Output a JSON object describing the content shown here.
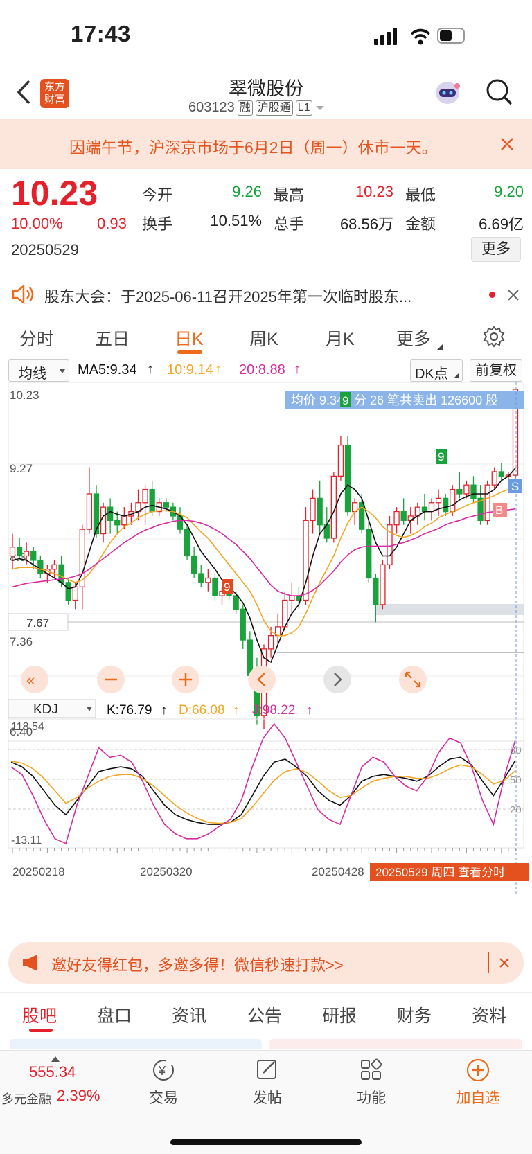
{
  "status_bar": {
    "time": "17:43"
  },
  "header": {
    "logo": "东方\n财富",
    "logo_top": "东方",
    "logo_bottom": "财富",
    "title": "翠微股份",
    "code": "603123",
    "tags": [
      "融",
      "沪股通",
      "L1"
    ]
  },
  "banner": {
    "text": "因端午节，沪深京市场于6月2日（周一）休市一天。"
  },
  "quote": {
    "price": "10.23",
    "change_pct": "10.00%",
    "change": "0.93",
    "date": "20250529",
    "open_label": "今开",
    "open": "9.26",
    "high_label": "最高",
    "high": "10.23",
    "low_label": "最低",
    "low": "9.20",
    "turnover_label": "换手",
    "turnover": "10.51%",
    "volume_label": "总手",
    "volume": "68.56万",
    "amount_label": "金额",
    "amount": "6.69亿",
    "more_label": "更多"
  },
  "notice": {
    "text": "股东大会：于2025-06-11召开2025年第一次临时股东..."
  },
  "tabs": [
    "分时",
    "五日",
    "日K",
    "周K",
    "月K",
    "更多"
  ],
  "ma": {
    "selector": "均线",
    "ma5": "MA5:9.34",
    "ma10": "10:9.14",
    "ma20": "20:8.88",
    "dk": "DK点",
    "adjust": "前复权"
  },
  "chart": {
    "axis_labels": [
      "10.23",
      "9.27",
      "8.3",
      "7.36",
      "6.40"
    ],
    "price_line_label": "7.67",
    "tooltip": "均价 9.342 分 26 笔共卖出 126600 股",
    "kdj_selector": "KDJ",
    "kdj_k": "K:76.79",
    "kdj_d": "D:66.08",
    "kdj_j": "J:98.22",
    "kdj_axis": [
      "118.54",
      "-13.11"
    ],
    "kdj_levels": [
      "80",
      "50",
      "20"
    ],
    "dates": [
      "20250218",
      "20250320",
      "20250428",
      "20250529"
    ],
    "date_tip": "20250529 周四 查看分时"
  },
  "chart_data": {
    "type": "candlestick",
    "ylim": [
      6.4,
      10.23
    ],
    "grid": true,
    "ohlc": [
      [
        8.35,
        8.6,
        8.2,
        8.45
      ],
      [
        8.45,
        8.55,
        8.3,
        8.35
      ],
      [
        8.35,
        8.5,
        8.25,
        8.4
      ],
      [
        8.4,
        8.45,
        8.2,
        8.3
      ],
      [
        8.3,
        8.35,
        8.1,
        8.15
      ],
      [
        8.15,
        8.25,
        8.05,
        8.2
      ],
      [
        8.2,
        8.3,
        8.1,
        8.25
      ],
      [
        8.25,
        8.35,
        8.0,
        8.05
      ],
      [
        8.05,
        8.1,
        7.8,
        7.85
      ],
      [
        7.85,
        8.05,
        7.75,
        8.0
      ],
      [
        8.0,
        8.7,
        7.75,
        8.65
      ],
      [
        8.65,
        9.35,
        8.6,
        9.05
      ],
      [
        9.05,
        9.15,
        8.55,
        8.6
      ],
      [
        8.6,
        8.95,
        8.5,
        8.9
      ],
      [
        8.9,
        9.0,
        8.6,
        8.75
      ],
      [
        8.75,
        8.85,
        8.6,
        8.7
      ],
      [
        8.7,
        8.9,
        8.65,
        8.8
      ],
      [
        8.8,
        8.95,
        8.7,
        8.85
      ],
      [
        8.85,
        9.1,
        8.75,
        8.95
      ],
      [
        8.95,
        9.15,
        8.7,
        9.1
      ],
      [
        9.1,
        9.2,
        8.8,
        8.85
      ],
      [
        8.85,
        9.0,
        8.8,
        8.95
      ],
      [
        8.95,
        9.0,
        8.85,
        8.9
      ],
      [
        8.9,
        8.95,
        8.75,
        8.8
      ],
      [
        8.8,
        8.9,
        8.6,
        8.65
      ],
      [
        8.65,
        8.7,
        8.3,
        8.35
      ],
      [
        8.35,
        8.45,
        8.1,
        8.15
      ],
      [
        8.15,
        8.25,
        8.0,
        8.05
      ],
      [
        8.05,
        8.2,
        7.95,
        8.1
      ],
      [
        8.1,
        8.15,
        7.85,
        7.9
      ],
      [
        7.9,
        8.0,
        7.8,
        7.95
      ],
      [
        7.95,
        8.05,
        7.85,
        7.9
      ],
      [
        7.9,
        7.95,
        7.7,
        7.75
      ],
      [
        7.75,
        7.8,
        7.3,
        7.4
      ],
      [
        7.4,
        7.5,
        6.9,
        7.0
      ],
      [
        7.0,
        7.2,
        6.45,
        6.55
      ],
      [
        6.55,
        7.35,
        6.4,
        7.3
      ],
      [
        7.3,
        7.55,
        7.2,
        7.45
      ],
      [
        7.45,
        7.7,
        7.35,
        7.55
      ],
      [
        7.55,
        7.95,
        7.5,
        7.85
      ],
      [
        7.85,
        8.05,
        7.7,
        7.9
      ],
      [
        7.9,
        8.0,
        7.75,
        7.85
      ],
      [
        7.85,
        8.9,
        7.8,
        8.75
      ],
      [
        8.75,
        9.1,
        8.6,
        9.0
      ],
      [
        9.0,
        9.2,
        8.6,
        8.7
      ],
      [
        8.7,
        8.9,
        8.5,
        8.55
      ],
      [
        8.55,
        9.3,
        8.5,
        9.25
      ],
      [
        9.25,
        9.7,
        9.2,
        9.6
      ],
      [
        9.6,
        9.7,
        8.8,
        8.85
      ],
      [
        8.85,
        9.0,
        8.7,
        8.95
      ],
      [
        8.95,
        9.05,
        8.6,
        8.65
      ],
      [
        8.65,
        8.75,
        8.05,
        8.1
      ],
      [
        8.1,
        8.15,
        7.6,
        7.8
      ],
      [
        7.8,
        8.3,
        7.75,
        8.25
      ],
      [
        8.25,
        8.8,
        8.2,
        8.7
      ],
      [
        8.7,
        8.9,
        8.6,
        8.85
      ],
      [
        8.85,
        9.0,
        8.7,
        8.75
      ],
      [
        8.75,
        8.9,
        8.6,
        8.8
      ],
      [
        8.8,
        8.95,
        8.7,
        8.9
      ],
      [
        8.9,
        9.05,
        8.75,
        8.85
      ],
      [
        8.85,
        9.0,
        8.75,
        8.95
      ],
      [
        8.95,
        9.1,
        8.8,
        9.0
      ],
      [
        9.0,
        9.05,
        8.8,
        8.85
      ],
      [
        8.85,
        9.15,
        8.8,
        9.1
      ],
      [
        9.1,
        9.3,
        9.0,
        9.05
      ],
      [
        9.05,
        9.2,
        9.0,
        9.15
      ],
      [
        9.15,
        9.25,
        8.95,
        9.0
      ],
      [
        9.0,
        9.15,
        8.7,
        8.75
      ],
      [
        8.75,
        9.2,
        8.7,
        9.15
      ],
      [
        9.15,
        9.35,
        9.1,
        9.3
      ],
      [
        9.3,
        9.4,
        9.2,
        9.25
      ],
      [
        9.25,
        9.3,
        9.2,
        9.26
      ],
      [
        9.26,
        10.23,
        9.2,
        10.23
      ]
    ],
    "ma5": [
      8.3,
      8.32,
      8.3,
      8.25,
      8.2,
      8.15,
      8.1,
      8.05,
      7.98,
      8.0,
      8.15,
      8.4,
      8.65,
      8.8,
      8.85,
      8.82,
      8.8,
      8.82,
      8.85,
      8.9,
      8.92,
      8.9,
      8.88,
      8.85,
      8.8,
      8.7,
      8.55,
      8.4,
      8.3,
      8.2,
      8.08,
      8.0,
      7.92,
      7.82,
      7.65,
      7.4,
      7.2,
      7.15,
      7.35,
      7.55,
      7.7,
      7.8,
      8.05,
      8.35,
      8.6,
      8.7,
      8.85,
      9.05,
      9.15,
      9.1,
      9.0,
      8.75,
      8.5,
      8.35,
      8.35,
      8.45,
      8.6,
      8.75,
      8.8,
      8.85,
      8.85,
      8.88,
      8.9,
      8.92,
      8.98,
      9.02,
      9.05,
      9.05,
      9.05,
      9.1,
      9.2,
      9.25,
      9.34
    ],
    "ma10": [
      8.2,
      8.22,
      8.22,
      8.22,
      8.2,
      8.18,
      8.15,
      8.12,
      8.08,
      8.05,
      8.08,
      8.15,
      8.25,
      8.38,
      8.5,
      8.6,
      8.68,
      8.72,
      8.78,
      8.82,
      8.85,
      8.86,
      8.86,
      8.85,
      8.82,
      8.78,
      8.7,
      8.62,
      8.55,
      8.45,
      8.35,
      8.25,
      8.15,
      8.05,
      7.95,
      7.8,
      7.62,
      7.5,
      7.45,
      7.45,
      7.48,
      7.55,
      7.7,
      7.88,
      8.05,
      8.2,
      8.35,
      8.55,
      8.72,
      8.85,
      8.9,
      8.85,
      8.78,
      8.68,
      8.62,
      8.58,
      8.56,
      8.58,
      8.62,
      8.68,
      8.72,
      8.78,
      8.82,
      8.85,
      8.88,
      8.92,
      8.95,
      8.97,
      9.0,
      9.03,
      9.07,
      9.1,
      9.14
    ],
    "ma20": [
      8.0,
      8.02,
      8.04,
      8.05,
      8.06,
      8.07,
      8.08,
      8.09,
      8.1,
      8.12,
      8.15,
      8.2,
      8.26,
      8.32,
      8.38,
      8.44,
      8.5,
      8.55,
      8.6,
      8.64,
      8.67,
      8.7,
      8.72,
      8.74,
      8.75,
      8.75,
      8.74,
      8.72,
      8.69,
      8.65,
      8.6,
      8.54,
      8.48,
      8.4,
      8.32,
      8.22,
      8.12,
      8.02,
      7.95,
      7.92,
      7.9,
      7.9,
      7.92,
      7.96,
      8.02,
      8.1,
      8.18,
      8.28,
      8.36,
      8.42,
      8.45,
      8.46,
      8.46,
      8.46,
      8.46,
      8.48,
      8.5,
      8.53,
      8.56,
      8.6,
      8.63,
      8.66,
      8.7,
      8.73,
      8.75,
      8.78,
      8.8,
      8.82,
      8.84,
      8.85,
      8.86,
      8.87,
      8.88
    ],
    "kdj_ylim": [
      -13.11,
      118.54
    ],
    "kdj_k": [
      75,
      70,
      60,
      45,
      30,
      20,
      35,
      50,
      65,
      68,
      70,
      68,
      60,
      45,
      30,
      20,
      15,
      12,
      10,
      10,
      12,
      20,
      40,
      60,
      75,
      78,
      70,
      60,
      45,
      35,
      30,
      40,
      55,
      60,
      62,
      60,
      58,
      55,
      60,
      70,
      78,
      80,
      72,
      55,
      40,
      58,
      76.79
    ],
    "kdj_d": [
      76,
      74,
      68,
      58,
      45,
      32,
      38,
      48,
      55,
      60,
      62,
      62,
      58,
      50,
      40,
      30,
      22,
      16,
      12,
      11,
      12,
      16,
      28,
      42,
      56,
      65,
      68,
      64,
      55,
      45,
      38,
      40,
      48,
      55,
      58,
      60,
      60,
      58,
      58,
      62,
      68,
      72,
      70,
      62,
      52,
      56,
      66.08
    ],
    "kdj_j": [
      70,
      62,
      40,
      15,
      -5,
      -10,
      30,
      60,
      90,
      80,
      82,
      75,
      55,
      30,
      10,
      0,
      -5,
      -5,
      0,
      8,
      15,
      35,
      70,
      100,
      115,
      100,
      75,
      50,
      25,
      15,
      10,
      40,
      70,
      80,
      75,
      60,
      50,
      45,
      60,
      85,
      100,
      95,
      70,
      35,
      10,
      60,
      98.22
    ]
  },
  "invite": {
    "text": "邀好友得红包，多邀多得！微信秒速打款>>"
  },
  "bottom_tabs": [
    "股吧",
    "盘口",
    "资讯",
    "公告",
    "研报",
    "财务",
    "资料"
  ],
  "dock": {
    "index_value": "555.34",
    "index_name": "多元金融",
    "index_pct": "2.39%",
    "items": [
      "交易",
      "发帖",
      "功能",
      "加自选"
    ]
  },
  "colors": {
    "up": "#e4212a",
    "down": "#1aa33c",
    "accent": "#ef6a1b",
    "ma5": "#111111",
    "ma10": "#f5a623",
    "ma20": "#d62ba1"
  }
}
